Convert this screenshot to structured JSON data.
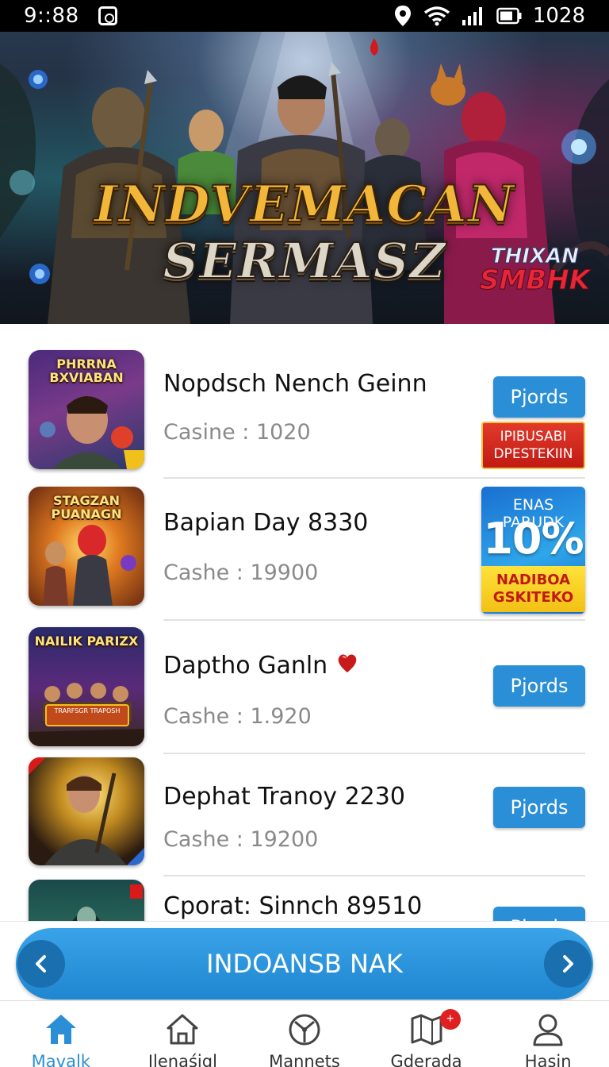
{
  "status_bar": {
    "time": "9::88",
    "battery_text": "1028"
  },
  "banner": {
    "title_line1": "INDVEMACAN",
    "title_line2": "SERMASZ",
    "badge_line1": "THIXAN",
    "badge_line2": "SMBHK"
  },
  "games": [
    {
      "thumb_title": "PHRRNA BXVIABAN",
      "title": "Nopdsch Nench Geinn",
      "cash": "Casine : 1020",
      "button": "Pjords",
      "promo": {
        "type": "red",
        "text": "IPIBUSABI DPESTEKIIN"
      }
    },
    {
      "thumb_title": "STAGZAN PUANAGN",
      "title": "Bapian Day 8330",
      "cash": "Cashe : 19900",
      "promo": {
        "type": "blue",
        "top": "ENAS PARUDK",
        "percent": "10%",
        "bottom": "NADIBOA GSKITEKO"
      }
    },
    {
      "thumb_title": "NAILIK PARIZX",
      "thumb_sub": "TRARFSGR TRAPOSH",
      "title": "Daptho Ganln",
      "cash": "Cashe : 1.920",
      "button": "Pjords"
    },
    {
      "title": "Dephat Tranoy 2230",
      "cash": "Cashe : 19200",
      "button": "Pjords"
    },
    {
      "title": "Cporat: Sinnch 89510",
      "button": "Pjords"
    }
  ],
  "pager": {
    "label": "INDOANSB NAK"
  },
  "nav": [
    {
      "label": "Mavalk",
      "icon": "home-icon",
      "active": true
    },
    {
      "label": "Ilenaśigl",
      "icon": "house-outline-icon"
    },
    {
      "label": "Mannets",
      "icon": "wheel-icon"
    },
    {
      "label": "Gderada",
      "icon": "map-icon",
      "badge": "+"
    },
    {
      "label": "Hasin",
      "icon": "profile-icon"
    }
  ],
  "colors": {
    "accent": "#2a8fd6",
    "promo_red": "#d42a1e",
    "promo_yellow": "#f6d02a"
  }
}
